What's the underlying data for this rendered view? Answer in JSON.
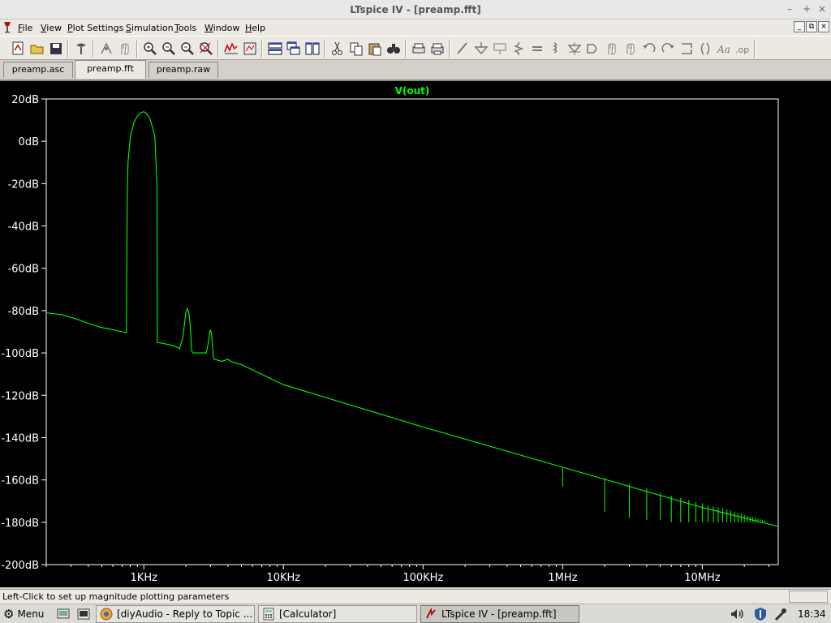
{
  "window": {
    "title": "LTspice IV - [preamp.fft]"
  },
  "menu": [
    "File",
    "View",
    "Plot Settings",
    "Simulation",
    "Tools",
    "Window",
    "Help"
  ],
  "menu_mnemonics": [
    "F",
    "V",
    "P",
    "S",
    "T",
    "W",
    "H"
  ],
  "toolbar_icons": [
    "new-schematic-icon",
    "open-icon",
    "save-icon",
    "control-panel-icon",
    "run-icon",
    "halt-icon",
    "zoom-in-icon",
    "zoom-out-icon",
    "zoom-back-icon",
    "zoom-fit-icon",
    "autorange-icon",
    "mark-unused-icon",
    "tile-horizontal-icon",
    "cascade-icon",
    "tile-vertical-icon",
    "cut-icon",
    "copy-icon",
    "paste-icon",
    "find-icon",
    "print-setup-icon",
    "print-icon",
    "wire-icon",
    "ground-icon",
    "label-icon",
    "resistor-icon",
    "capacitor-icon",
    "inductor-icon",
    "diode-icon",
    "component-icon",
    "move-icon",
    "drag-icon",
    "undo-icon",
    "redo-icon",
    "rotate-icon",
    "mirror-icon",
    "text-icon",
    "spice-directive-icon"
  ],
  "tabs": [
    {
      "label": "preamp.asc"
    },
    {
      "label": "preamp.fft",
      "active": true
    },
    {
      "label": "preamp.raw"
    }
  ],
  "status": {
    "text": "Left-Click to set up magnitude plotting parameters"
  },
  "taskbar": {
    "menu_label": "Menu",
    "items": [
      {
        "label": "[diyAudio - Reply to Topic ..."
      },
      {
        "label": "[Calculator]"
      },
      {
        "label": "LTspice IV - [preamp.fft]",
        "active": true
      }
    ],
    "clock": "18:34"
  },
  "colors": {
    "trace": "#00ff00",
    "axis": "#ffffff",
    "background": "#000000",
    "trace_label": "#00ff00"
  },
  "chart_data": {
    "type": "line",
    "title": "V(out)",
    "xscale": "log",
    "xlim": [
      200,
      35000000
    ],
    "ylim": [
      -200,
      20
    ],
    "y_ticks": [
      20,
      0,
      -20,
      -40,
      -60,
      -80,
      -100,
      -120,
      -140,
      -160,
      -180,
      -200
    ],
    "y_tick_labels": [
      "20dB",
      "0dB",
      "-20dB",
      "-40dB",
      "-60dB",
      "-80dB",
      "-100dB",
      "-120dB",
      "-140dB",
      "-160dB",
      "-180dB",
      "-200dB"
    ],
    "x_ticks": [
      1000,
      10000,
      100000,
      1000000,
      10000000
    ],
    "x_tick_labels": [
      "1KHz",
      "10KHz",
      "100KHz",
      "1MHz",
      "10MHz"
    ],
    "grid": false,
    "series": [
      {
        "name": "V(out)",
        "x": [
          200,
          260,
          330,
          400,
          500,
          600,
          700,
          750,
          760,
          770,
          800,
          850,
          900,
          950,
          1000,
          1050,
          1100,
          1150,
          1200,
          1240,
          1250,
          1500,
          1700,
          1800,
          1900,
          1950,
          2000,
          2050,
          2100,
          2150,
          2200,
          2250,
          2500,
          2700,
          2800,
          2900,
          2950,
          3000,
          3050,
          3100,
          3150,
          3200,
          3400,
          3600,
          3800,
          4000,
          4200,
          4400,
          5000,
          10000,
          100000,
          1000000,
          10000000,
          35000000
        ],
        "y": [
          -81,
          -82,
          -84,
          -86,
          -88,
          -89,
          -90,
          -90.5,
          -30,
          -10,
          2,
          9,
          12,
          13.5,
          14,
          13,
          11,
          7,
          2,
          -20,
          -95,
          -96,
          -97,
          -98,
          -93,
          -87,
          -81,
          -79,
          -81,
          -87,
          -99,
          -100,
          -100,
          -100,
          -100,
          -95,
          -91,
          -89,
          -91,
          -96,
          -102,
          -103,
          -103.5,
          -104,
          -103.5,
          -103,
          -104,
          -104.5,
          -105.5,
          -115,
          -135,
          -154,
          -173,
          -182
        ]
      }
    ],
    "notches": [
      {
        "x": 1000000,
        "y": [
          -154,
          -163
        ]
      },
      {
        "x": 2000000,
        "y": [
          -159,
          -175
        ]
      },
      {
        "x": 3000000,
        "y": [
          -162,
          -178
        ]
      },
      {
        "x": 4000000,
        "y": [
          -164,
          -179
        ]
      },
      {
        "x": 5000000,
        "y": [
          -166,
          -179
        ]
      },
      {
        "x": 6000000,
        "y": [
          -167.5,
          -180
        ]
      },
      {
        "x": 7000000,
        "y": [
          -168.5,
          -180
        ]
      },
      {
        "x": 8000000,
        "y": [
          -169.5,
          -180
        ]
      },
      {
        "x": 9000000,
        "y": [
          -170.5,
          -180
        ]
      },
      {
        "x": 10000000,
        "y": [
          -171,
          -180
        ]
      },
      {
        "x": 11000000,
        "y": [
          -172,
          -180
        ]
      },
      {
        "x": 12000000,
        "y": [
          -172.5,
          -180
        ]
      },
      {
        "x": 13000000,
        "y": [
          -173,
          -180
        ]
      },
      {
        "x": 14000000,
        "y": [
          -173.5,
          -180
        ]
      },
      {
        "x": 15000000,
        "y": [
          -174,
          -180
        ]
      },
      {
        "x": 16000000,
        "y": [
          -174.5,
          -180
        ]
      },
      {
        "x": 17000000,
        "y": [
          -175,
          -180
        ]
      },
      {
        "x": 18000000,
        "y": [
          -175.5,
          -180
        ]
      },
      {
        "x": 19000000,
        "y": [
          -176,
          -180
        ]
      },
      {
        "x": 20000000,
        "y": [
          -176.5,
          -180
        ]
      },
      {
        "x": 21000000,
        "y": [
          -177,
          -180
        ]
      },
      {
        "x": 22000000,
        "y": [
          -177.3,
          -180
        ]
      },
      {
        "x": 23000000,
        "y": [
          -177.6,
          -180
        ]
      },
      {
        "x": 24000000,
        "y": [
          -178,
          -180
        ]
      },
      {
        "x": 25000000,
        "y": [
          -178.3,
          -180
        ]
      },
      {
        "x": 26000000,
        "y": [
          -178.6,
          -180
        ]
      },
      {
        "x": 27000000,
        "y": [
          -179,
          -180
        ]
      },
      {
        "x": 28000000,
        "y": [
          -179.3,
          -180
        ]
      },
      {
        "x": 29000000,
        "y": [
          -179.6,
          -180
        ]
      }
    ]
  }
}
